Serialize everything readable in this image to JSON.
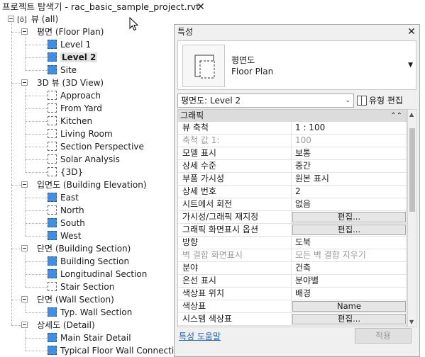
{
  "project_browser": {
    "title": "프로젝트 탐색기 - rac_basic_sample_project.rvt",
    "root_label": "뷰 (all)",
    "groups": [
      {
        "label": "평면 (Floor Plan)",
        "items": [
          {
            "label": "Level 1",
            "icon": "blue-view-icon"
          },
          {
            "label": "Level 2",
            "icon": "blue-view-icon",
            "selected": true
          },
          {
            "label": "Site",
            "icon": "blue-view-icon"
          }
        ]
      },
      {
        "label": "3D 뷰 (3D View)",
        "items": [
          {
            "label": "Approach",
            "icon": "white-view-icon"
          },
          {
            "label": "From Yard",
            "icon": "white-view-icon"
          },
          {
            "label": "Kitchen",
            "icon": "white-view-icon"
          },
          {
            "label": "Living Room",
            "icon": "white-view-icon"
          },
          {
            "label": "Section Perspective",
            "icon": "white-view-icon"
          },
          {
            "label": "Solar Analysis",
            "icon": "white-view-icon"
          },
          {
            "label": "{3D}",
            "icon": "white-view-icon"
          }
        ]
      },
      {
        "label": "입면도 (Building Elevation)",
        "items": [
          {
            "label": "East",
            "icon": "blue-view-icon"
          },
          {
            "label": "North",
            "icon": "white-view-icon"
          },
          {
            "label": "South",
            "icon": "blue-view-icon"
          },
          {
            "label": "West",
            "icon": "blue-view-icon"
          }
        ]
      },
      {
        "label": "단면 (Building Section)",
        "items": [
          {
            "label": "Building Section",
            "icon": "blue-view-icon"
          },
          {
            "label": "Longitudinal Section",
            "icon": "blue-view-icon"
          },
          {
            "label": "Stair Section",
            "icon": "white-view-icon"
          }
        ]
      },
      {
        "label": "단면 (Wall Section)",
        "items": [
          {
            "label": "Typ. Wall Section",
            "icon": "blue-view-icon"
          }
        ]
      },
      {
        "label": "상세도 (Detail)",
        "items": [
          {
            "label": "Main Stair Detail",
            "icon": "blue-view-icon"
          },
          {
            "label": "Typical Floor Wall Connection",
            "icon": "blue-view-icon"
          }
        ]
      }
    ]
  },
  "properties": {
    "title": "특성",
    "type_selector": {
      "line1": "평면도",
      "line2": "Floor Plan"
    },
    "instance_filter": "평면도: Level 2",
    "edit_type_label": "유형 편집",
    "group_header": "그래픽",
    "rows": [
      {
        "name": "뷰 축척",
        "value": "1 : 100",
        "kind": "text"
      },
      {
        "name": "축척 값    1:",
        "value": "100",
        "kind": "text",
        "dim": true
      },
      {
        "name": "모델 표시",
        "value": "보통",
        "kind": "text"
      },
      {
        "name": "상세 수준",
        "value": "중간",
        "kind": "text"
      },
      {
        "name": "부품 가시성",
        "value": "원본 표시",
        "kind": "text"
      },
      {
        "name": "상세 번호",
        "value": "2",
        "kind": "text"
      },
      {
        "name": "시트에서 회전",
        "value": "없음",
        "kind": "text"
      },
      {
        "name": "가시성/그래픽 재지정",
        "value": "편집...",
        "kind": "button"
      },
      {
        "name": "그래픽 화면표시 옵션",
        "value": "편집...",
        "kind": "button"
      },
      {
        "name": "방향",
        "value": "도북",
        "kind": "text"
      },
      {
        "name": "벽 결합 화면표시",
        "value": "모든 벽 결합 지우기",
        "kind": "text",
        "dim": true
      },
      {
        "name": "분야",
        "value": "건축",
        "kind": "text"
      },
      {
        "name": "은선 표시",
        "value": "분야별",
        "kind": "text"
      },
      {
        "name": "색상표 위치",
        "value": "배경",
        "kind": "text"
      },
      {
        "name": "색상표",
        "value": "Name",
        "kind": "button"
      },
      {
        "name": "시스템 색상표",
        "value": "편집...",
        "kind": "button"
      }
    ],
    "help_link": "특성 도움말",
    "apply_label": "적용"
  }
}
